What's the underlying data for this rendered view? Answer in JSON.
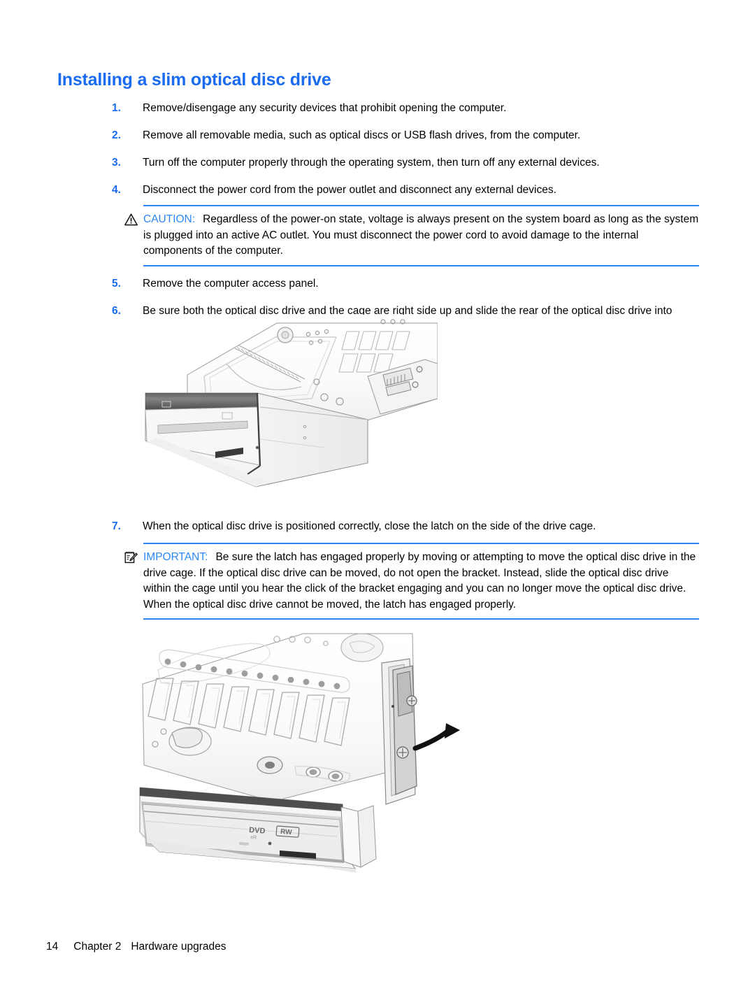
{
  "page": {
    "heading": "Installing a slim optical disc drive",
    "accent_color": "#1A6BF0",
    "rule_color": "#2E86F5",
    "background": "#ffffff"
  },
  "steps": [
    {
      "number": "1.",
      "text": "Remove/disengage any security devices that prohibit opening the computer."
    },
    {
      "number": "2.",
      "text": "Remove all removable media, such as optical discs or USB flash drives, from the computer."
    },
    {
      "number": "3.",
      "text": "Turn off the computer properly through the operating system, then turn off any external devices."
    },
    {
      "number": "4.",
      "text": "Disconnect the power cord from the power outlet and disconnect any external devices."
    },
    {
      "number": "5.",
      "text": "Remove the computer access panel."
    },
    {
      "number": "6.",
      "text": "Be sure both the optical disc drive and the cage are right side up and slide the rear of the optical disc drive into through the front of the drive cage."
    },
    {
      "number": "7.",
      "text": "When the optical disc drive is positioned correctly, close the latch on the side of the drive cage."
    }
  ],
  "caution": {
    "icon": "warning-triangle-icon",
    "label": "CAUTION:",
    "text": "Regardless of the power-on state, voltage is always present on the system board as long as the system is plugged into an active AC outlet. You must disconnect the power cord to avoid damage to the internal components of the computer."
  },
  "important": {
    "icon": "notepad-pencil-icon",
    "label": "IMPORTANT:",
    "text": "Be sure the latch has engaged properly by moving or attempting to move the optical disc drive in the drive cage. If the optical disc drive can be moved, do not open the bracket. Instead, slide the optical disc drive within the cage until you hear the click of the bracket engaging and you can no longer move the optical disc drive. When the optical disc drive cannot be moved, the latch has engaged properly."
  },
  "figures": [
    {
      "name": "optical-drive-in-cage-photo",
      "caption": "",
      "alt": "Slim optical disc drive being slid into the front of the drive cage"
    },
    {
      "name": "drive-cage-latch-photo",
      "caption": "",
      "alt": "Drive cage latch being closed on the side of the cage, with DVD RW drive installed",
      "drive_label_1": "DVD",
      "drive_label_2": "RW"
    }
  ],
  "footer": {
    "page_number": "14",
    "chapter": "Chapter 2",
    "chapter_title": "Hardware upgrades"
  }
}
